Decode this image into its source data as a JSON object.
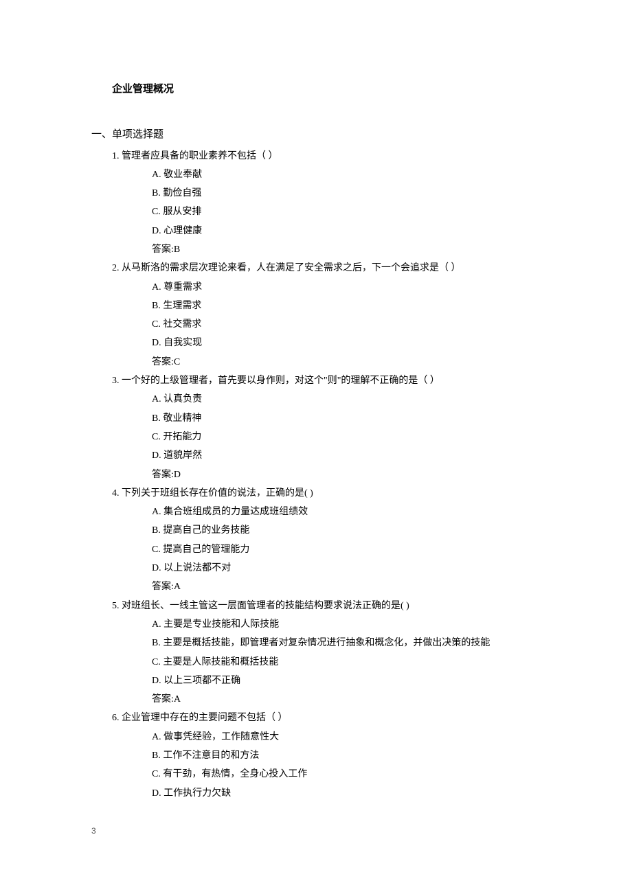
{
  "title": "企业管理概况",
  "section": "一、单项选择题",
  "answer_prefix": "答案:",
  "page_number": "3",
  "questions": [
    {
      "num": "1.",
      "stem": "管理者应具备的职业素养不包括（ ）",
      "options": [
        {
          "label": "A.",
          "text": "敬业奉献"
        },
        {
          "label": "B.",
          "text": "勤俭自强"
        },
        {
          "label": "C.",
          "text": "服从安排"
        },
        {
          "label": "D.",
          "text": "心理健康"
        }
      ],
      "answer": "B"
    },
    {
      "num": "2.",
      "stem": "从马斯洛的需求层次理论来看，人在满足了安全需求之后，下一个会追求是（ ）",
      "options": [
        {
          "label": "A.",
          "text": "尊重需求"
        },
        {
          "label": "B.",
          "text": "生理需求"
        },
        {
          "label": "C.",
          "text": "社交需求"
        },
        {
          "label": "D.",
          "text": "自我实现"
        }
      ],
      "answer": "C"
    },
    {
      "num": "3.",
      "stem": "一个好的上级管理者，首先要以身作则，对这个\"则\"的理解不正确的是（ ）",
      "options": [
        {
          "label": "A.",
          "text": "认真负责"
        },
        {
          "label": "B.",
          "text": "敬业精神"
        },
        {
          "label": "C.",
          "text": "开拓能力"
        },
        {
          "label": "D.",
          "text": "道貌岸然"
        }
      ],
      "answer": "D"
    },
    {
      "num": "4.",
      "stem": "下列关于班组长存在价值的说法，正确的是( )",
      "options": [
        {
          "label": "A.",
          "text": "集合班组成员的力量达成班组绩效"
        },
        {
          "label": "B.",
          "text": "提高自己的业务技能"
        },
        {
          "label": "C.",
          "text": "提高自己的管理能力"
        },
        {
          "label": "D.",
          "text": "以上说法都不对"
        }
      ],
      "answer": "A"
    },
    {
      "num": "5.",
      "stem": "对班组长、一线主管这一层面管理者的技能结构要求说法正确的是( )",
      "options": [
        {
          "label": "A.",
          "text": "主要是专业技能和人际技能"
        },
        {
          "label": "B.",
          "text": "主要是概括技能，即管理者对复杂情况进行抽象和概念化，并做出决策的技能"
        },
        {
          "label": "C.",
          "text": "主要是人际技能和概括技能"
        },
        {
          "label": "D.",
          "text": "以上三项都不正确"
        }
      ],
      "answer": "A"
    },
    {
      "num": "6.",
      "stem": "企业管理中存在的主要问题不包括（ ）",
      "options": [
        {
          "label": "A.",
          "text": "做事凭经验，工作随意性大"
        },
        {
          "label": "B.",
          "text": "工作不注意目的和方法"
        },
        {
          "label": "C.",
          "text": "有干劲，有热情，全身心投入工作"
        },
        {
          "label": "D.",
          "text": "工作执行力欠缺"
        }
      ],
      "answer": null
    }
  ]
}
